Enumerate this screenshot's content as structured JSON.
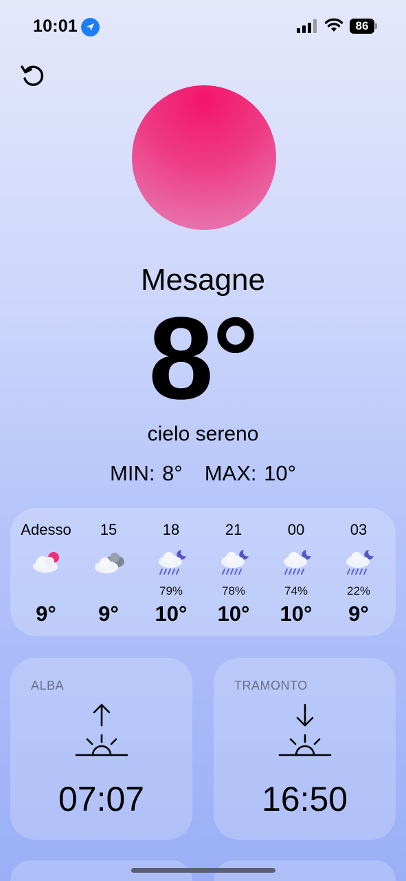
{
  "status_bar": {
    "time": "10:01",
    "battery": "86",
    "icons": [
      "location-arrow-icon",
      "cellular-signal-icon",
      "wifi-icon",
      "battery-icon"
    ]
  },
  "toolbar": {
    "refresh_icon": "refresh-icon"
  },
  "weather": {
    "city": "Mesagne",
    "temperature": "8°",
    "description": "cielo sereno",
    "min": "MIN: 8°",
    "max": "MAX: 10°",
    "sun_color": "#f4156b"
  },
  "hourly": [
    {
      "label": "Adesso",
      "icon": "partly-cloudy-sun-icon",
      "precip": "",
      "temp": "9°"
    },
    {
      "label": "15",
      "icon": "cloudy-icon",
      "precip": "",
      "temp": "9°"
    },
    {
      "label": "18",
      "icon": "rain-night-icon",
      "precip": "79%",
      "temp": "10°"
    },
    {
      "label": "21",
      "icon": "rain-night-icon",
      "precip": "78%",
      "temp": "10°"
    },
    {
      "label": "00",
      "icon": "rain-night-icon",
      "precip": "74%",
      "temp": "10°"
    },
    {
      "label": "03",
      "icon": "rain-night-icon",
      "precip": "22%",
      "temp": "9°"
    }
  ],
  "sunrise": {
    "title": "ALBA",
    "time": "07:07",
    "icon": "sunrise-icon"
  },
  "sunset": {
    "title": "TRAMONTO",
    "time": "16:50",
    "icon": "sunset-icon"
  }
}
